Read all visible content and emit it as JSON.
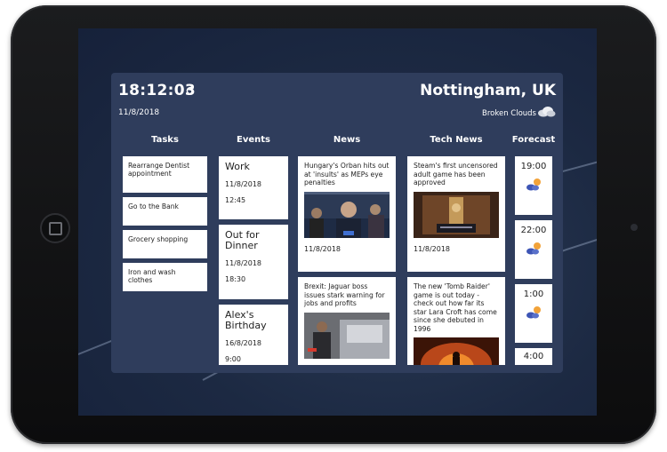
{
  "header": {
    "clock": "18:12:03",
    "date": "11/8/2018",
    "city": "Nottingham, UK",
    "weather": "Broken Clouds"
  },
  "columns": {
    "tasks": "Tasks",
    "events": "Events",
    "news": "News",
    "tech_news": "Tech News",
    "forecast": "Forecast"
  },
  "tasks": [
    "Rearrange Dentist appointment",
    "Go to the Bank",
    "Grocery shopping",
    "Iron and wash clothes"
  ],
  "events": [
    {
      "title": "Work",
      "date": "11/8/2018",
      "time": "12:45"
    },
    {
      "title": "Out for Dinner",
      "date": "11/8/2018",
      "time": "18:30"
    },
    {
      "title": "Alex's Birthday",
      "date": "16/8/2018",
      "time": "9:00"
    }
  ],
  "news": [
    {
      "headline": "Hungary's Orban hits out at 'insults' as MEPs eye penalties",
      "date": "11/8/2018"
    },
    {
      "headline": "Brexit: Jaguar boss issues stark warning for jobs and profits",
      "date": ""
    }
  ],
  "tech_news": [
    {
      "headline": "Steam's first uncensored adult game has been approved",
      "date": "11/8/2018"
    },
    {
      "headline": "The new 'Tomb Raider' game is out today - check out how far its star Lara Croft has come since she debuted in 1996",
      "date": ""
    }
  ],
  "forecast": [
    {
      "time": "19:00",
      "icon": "cloud-sun-icon"
    },
    {
      "time": "22:00",
      "icon": "cloud-sun-icon"
    },
    {
      "time": "1:00",
      "icon": "cloud-sun-icon"
    },
    {
      "time": "4:00",
      "icon": "cloud-sun-icon"
    }
  ],
  "colors": {
    "panel": "#2f3d5c",
    "screen": "#1c2942",
    "card": "#ffffff",
    "bezel": "#141516"
  }
}
